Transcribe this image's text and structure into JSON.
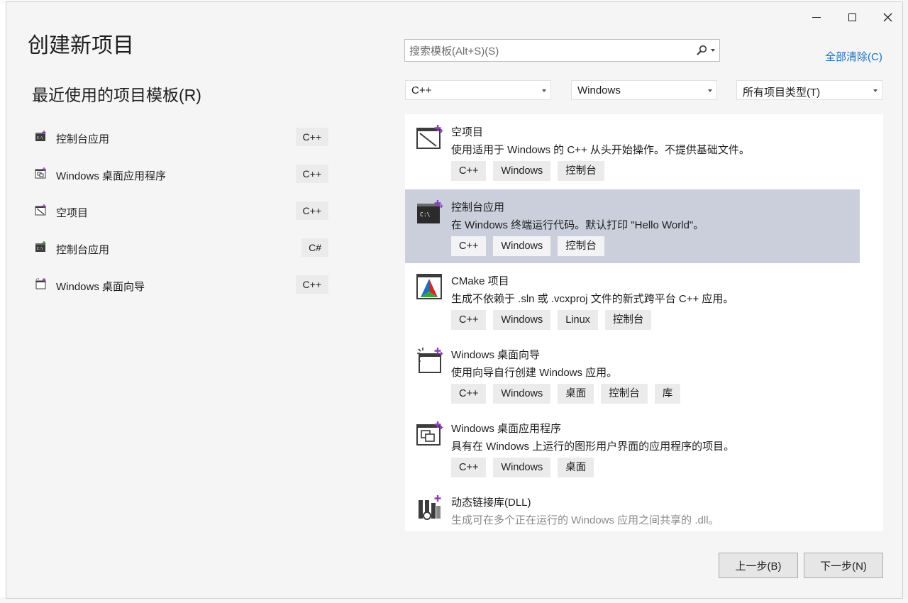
{
  "dialog": {
    "title": "创建新项目",
    "recent_header": "最近使用的项目模板(R)",
    "clear_all": "全部清除(C)"
  },
  "recent": [
    {
      "name": "控制台应用",
      "lang": "C++",
      "icon": "console-app-icon"
    },
    {
      "name": "Windows 桌面应用程序",
      "lang": "C++",
      "icon": "desktop-app-icon"
    },
    {
      "name": "空项目",
      "lang": "C++",
      "icon": "empty-project-icon"
    },
    {
      "name": "控制台应用",
      "lang": "C#",
      "icon": "console-app-icon"
    },
    {
      "name": "Windows 桌面向导",
      "lang": "C++",
      "icon": "desktop-wizard-icon"
    }
  ],
  "search": {
    "placeholder": "搜索模板(Alt+S)(S)",
    "icon": "search-icon"
  },
  "filters": {
    "language": "C++",
    "platform": "Windows",
    "project_type": "所有项目类型(T)"
  },
  "templates": [
    {
      "name": "空项目",
      "desc": "使用适用于 Windows 的 C++ 从头开始操作。不提供基础文件。",
      "tags": [
        "C++",
        "Windows",
        "控制台"
      ],
      "icon": "empty-project-icon"
    },
    {
      "name": "控制台应用",
      "desc": "在 Windows 终端运行代码。默认打印 \"Hello World\"。",
      "tags": [
        "C++",
        "Windows",
        "控制台"
      ],
      "icon": "console-app-icon",
      "selected": true
    },
    {
      "name": "CMake 项目",
      "desc": "生成不依赖于 .sln 或 .vcxproj 文件的新式跨平台 C++ 应用。",
      "tags": [
        "C++",
        "Windows",
        "Linux",
        "控制台"
      ],
      "icon": "cmake-icon"
    },
    {
      "name": "Windows 桌面向导",
      "desc": "使用向导自行创建 Windows 应用。",
      "tags": [
        "C++",
        "Windows",
        "桌面",
        "控制台",
        "库"
      ],
      "icon": "desktop-wizard-icon"
    },
    {
      "name": "Windows 桌面应用程序",
      "desc": "具有在 Windows 上运行的图形用户界面的应用程序的项目。",
      "tags": [
        "C++",
        "Windows",
        "桌面"
      ],
      "icon": "desktop-app-icon"
    },
    {
      "name": "动态链接库(DLL)",
      "desc": "生成可在多个正在运行的 Windows 应用之间共享的 .dll。",
      "tags": [],
      "icon": "dll-icon"
    }
  ],
  "buttons": {
    "back": "上一步(B)",
    "next": "下一步(N)"
  },
  "colors": {
    "selected_row": "#cbcfdc",
    "link": "#1a6fbd",
    "tag_bg": "#ebebeb"
  }
}
